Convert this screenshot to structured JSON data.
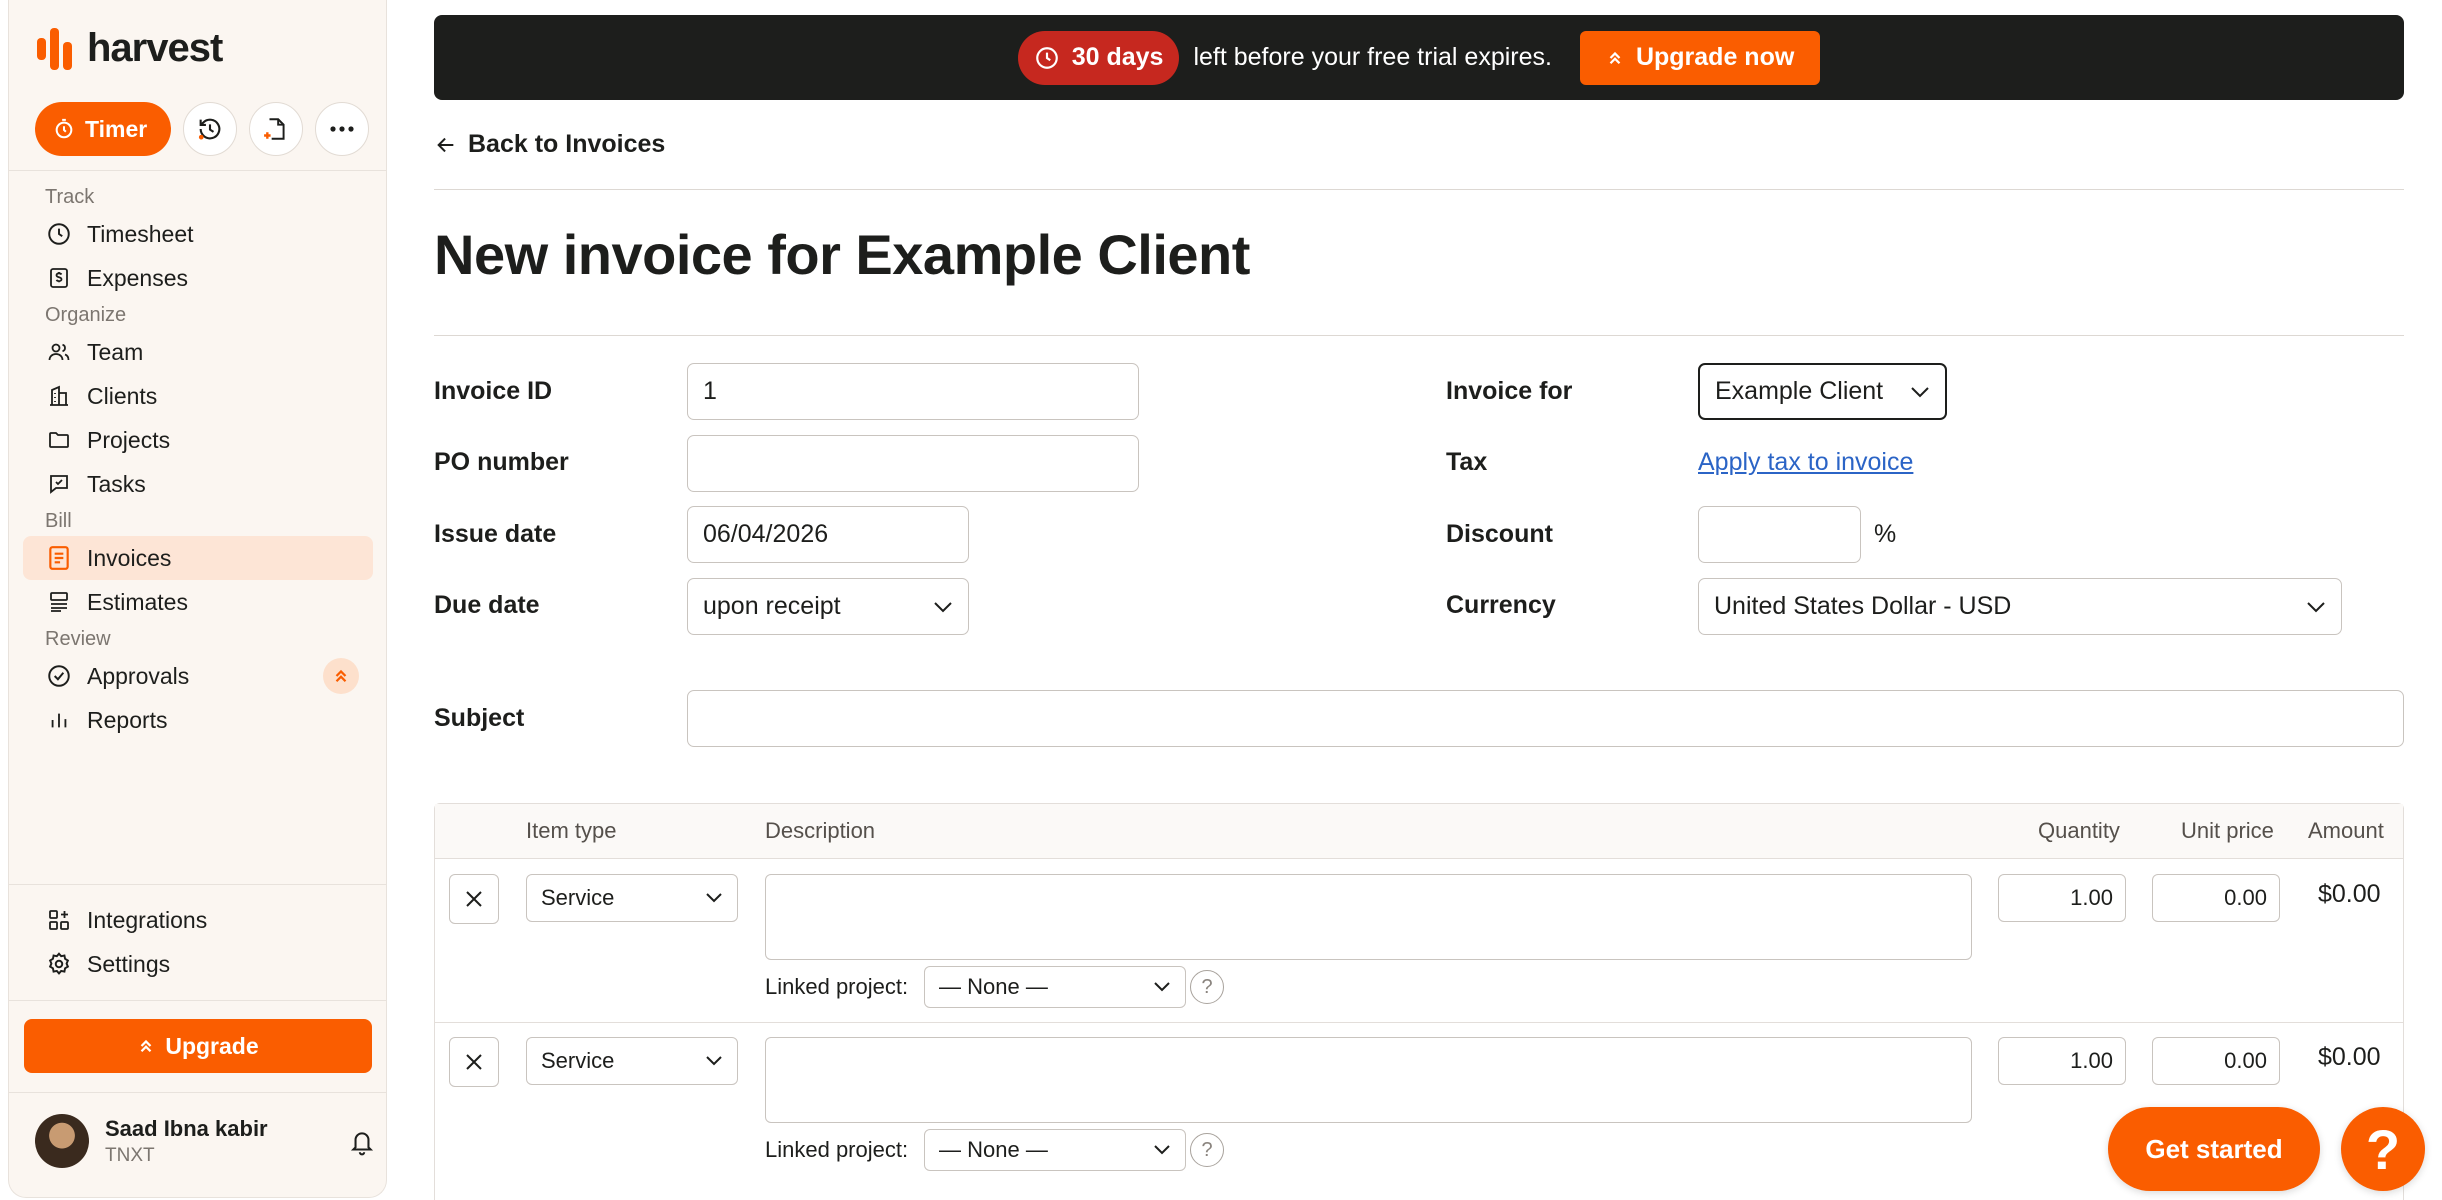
{
  "app": {
    "name": "harvest"
  },
  "quick_actions": {
    "timer_label": "Timer",
    "recent_icon": "clock-history-icon",
    "new_doc_icon": "document-add-icon",
    "more_icon": "more-icon"
  },
  "nav": {
    "sections": [
      {
        "title": "Track",
        "items": [
          {
            "label": "Timesheet",
            "icon": "clock-icon"
          },
          {
            "label": "Expenses",
            "icon": "receipt-icon"
          }
        ]
      },
      {
        "title": "Organize",
        "items": [
          {
            "label": "Team",
            "icon": "team-icon"
          },
          {
            "label": "Clients",
            "icon": "building-icon"
          },
          {
            "label": "Projects",
            "icon": "folder-icon"
          },
          {
            "label": "Tasks",
            "icon": "tasks-icon"
          }
        ]
      },
      {
        "title": "Bill",
        "items": [
          {
            "label": "Invoices",
            "icon": "invoice-icon",
            "active": true
          },
          {
            "label": "Estimates",
            "icon": "estimate-icon"
          }
        ]
      },
      {
        "title": "Review",
        "items": [
          {
            "label": "Approvals",
            "icon": "check-circle-icon"
          },
          {
            "label": "Reports",
            "icon": "bar-chart-icon"
          }
        ]
      }
    ],
    "bottom": [
      {
        "label": "Integrations",
        "icon": "integrations-icon"
      },
      {
        "label": "Settings",
        "icon": "gear-icon"
      }
    ]
  },
  "sidebar_upgrade_label": "Upgrade",
  "profile": {
    "name": "Saad Ibna kabir",
    "org": "TNXT"
  },
  "banner": {
    "days": "30 days",
    "message": "left before your free trial expires.",
    "cta": "Upgrade now"
  },
  "back_link": "Back to Invoices",
  "title": "New invoice for Example Client",
  "form": {
    "invoice_id": {
      "label": "Invoice ID",
      "value": "1"
    },
    "po_number": {
      "label": "PO number",
      "value": ""
    },
    "issue_date": {
      "label": "Issue date",
      "value": "06/04/2026"
    },
    "due_date": {
      "label": "Due date",
      "value": "upon receipt"
    },
    "invoice_for": {
      "label": "Invoice for",
      "value": "Example Client"
    },
    "tax": {
      "label": "Tax",
      "link": "Apply tax to invoice"
    },
    "discount": {
      "label": "Discount",
      "value": "",
      "unit": "%"
    },
    "currency": {
      "label": "Currency",
      "value": "United States Dollar - USD"
    },
    "subject": {
      "label": "Subject",
      "value": ""
    }
  },
  "items_table": {
    "headers": {
      "item_type": "Item type",
      "description": "Description",
      "quantity": "Quantity",
      "unit_price": "Unit price",
      "amount": "Amount"
    },
    "linked_project_label": "Linked project:",
    "rows": [
      {
        "item_type": "Service",
        "description": "",
        "quantity": "1.00",
        "unit_price": "0.00",
        "amount": "$0.00",
        "linked_project": "— None —"
      },
      {
        "item_type": "Service",
        "description": "",
        "quantity": "1.00",
        "unit_price": "0.00",
        "amount": "$0.00",
        "linked_project": "— None —"
      }
    ]
  },
  "get_started": "Get started",
  "help": "?",
  "colors": {
    "accent": "#fa5d00",
    "banner_bg": "#1d1e1c",
    "days_pill": "#c6281f",
    "link": "#2b64c6",
    "sidebar_bg": "#fbf6f1",
    "active_nav_bg": "#fde5d6"
  }
}
